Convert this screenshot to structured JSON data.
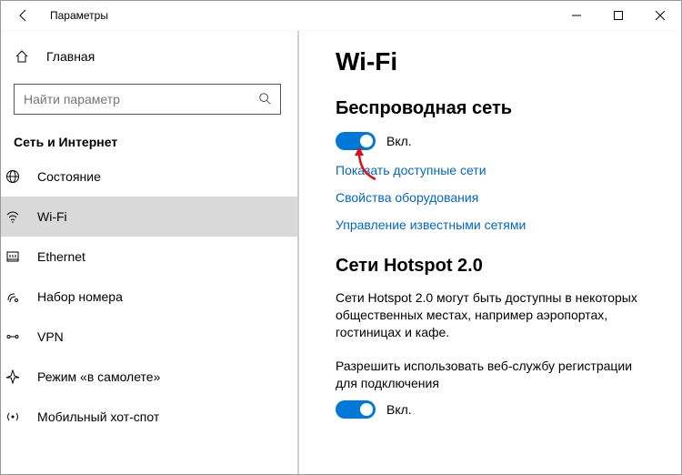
{
  "titlebar": {
    "title": "Параметры"
  },
  "sidebar": {
    "home_label": "Главная",
    "search_placeholder": "Найти параметр",
    "section_label": "Сеть и Интернет",
    "items": [
      {
        "label": "Состояние"
      },
      {
        "label": "Wi-Fi"
      },
      {
        "label": "Ethernet"
      },
      {
        "label": "Набор номера"
      },
      {
        "label": "VPN"
      },
      {
        "label": "Режим «в самолете»"
      },
      {
        "label": "Мобильный хот-спот"
      }
    ]
  },
  "content": {
    "page_title": "Wi-Fi",
    "wireless": {
      "heading": "Беспроводная сеть",
      "toggle_state": "Вкл.",
      "links": {
        "show_networks": "Показать доступные сети",
        "hw_props": "Свойства оборудования",
        "manage_known": "Управление известными сетями"
      }
    },
    "hotspot20": {
      "heading": "Сети Hotspot 2.0",
      "description": "Сети Hotspot 2.0 могут быть доступны в некоторых общественных местах, например аэропортах, гостиницах и кафе.",
      "allow_label": "Разрешить использовать веб-службу регистрации для подключения",
      "toggle_state": "Вкл."
    }
  }
}
